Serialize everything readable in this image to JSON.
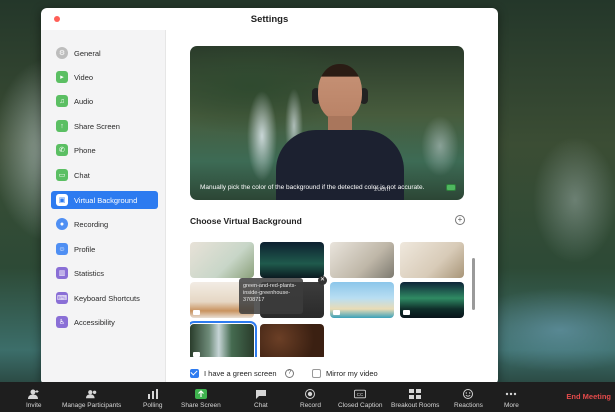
{
  "window": {
    "title": "Settings"
  },
  "sidebar": {
    "items": [
      {
        "label": "General",
        "icon": "gear-icon",
        "color": "#bdbdbd"
      },
      {
        "label": "Video",
        "icon": "video-camera-icon",
        "color": "#5bbf63"
      },
      {
        "label": "Audio",
        "icon": "headphones-icon",
        "color": "#5bbf63"
      },
      {
        "label": "Share Screen",
        "icon": "share-screen-icon",
        "color": "#5bbf63"
      },
      {
        "label": "Phone",
        "icon": "phone-icon",
        "color": "#5bbf63"
      },
      {
        "label": "Chat",
        "icon": "chat-bubble-icon",
        "color": "#5bbf63"
      },
      {
        "label": "Virtual Background",
        "icon": "person-background-icon",
        "color": "#2d7bf0",
        "active": true
      },
      {
        "label": "Recording",
        "icon": "record-icon",
        "color": "#4f8ff3"
      },
      {
        "label": "Profile",
        "icon": "profile-icon",
        "color": "#4f8ff3"
      },
      {
        "label": "Statistics",
        "icon": "statistics-icon",
        "color": "#8a6fd6"
      },
      {
        "label": "Keyboard Shortcuts",
        "icon": "keyboard-icon",
        "color": "#8a6fd6"
      },
      {
        "label": "Accessibility",
        "icon": "accessibility-icon",
        "color": "#8a6fd6"
      }
    ]
  },
  "preview": {
    "caption": "Manually pick the color of the background if the detected color is not accurate.",
    "brand": "zoom"
  },
  "gallery": {
    "title": "Choose Virtual Background",
    "tooltip": "green-and-red-plants-inside-greenhouse-3708717"
  },
  "options": {
    "green_screen": "I have a green screen",
    "mirror": "Mirror my video"
  },
  "toolbar": {
    "items": [
      {
        "label": "Invite",
        "icon": "invite-icon"
      },
      {
        "label": "Manage Participants",
        "icon": "participants-icon"
      },
      {
        "label": "Polling",
        "icon": "polling-icon"
      },
      {
        "label": "Share Screen",
        "icon": "share-screen-icon"
      },
      {
        "label": "Chat",
        "icon": "chat-icon"
      },
      {
        "label": "Record",
        "icon": "record-icon"
      },
      {
        "label": "Closed Caption",
        "icon": "cc-icon"
      },
      {
        "label": "Breakout Rooms",
        "icon": "breakout-icon"
      },
      {
        "label": "Reactions",
        "icon": "reactions-icon"
      },
      {
        "label": "More",
        "icon": "more-icon"
      }
    ],
    "end": "End Meeting"
  }
}
